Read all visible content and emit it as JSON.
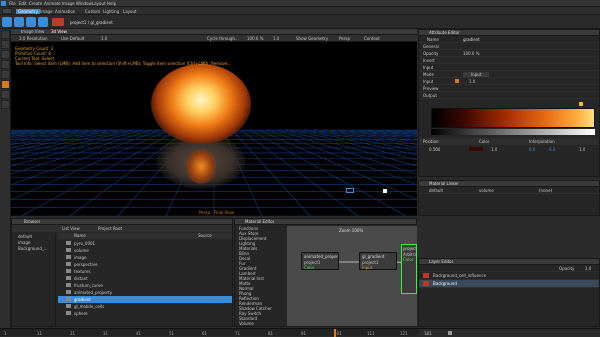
{
  "menubar": {
    "items": [
      "File",
      "Edit",
      "Create",
      "Animate",
      "Image",
      "Window",
      "Layout",
      "Help"
    ]
  },
  "toolbar": {
    "tabs": [
      "Geometry",
      "Image",
      "Animation",
      "Custom",
      "Lighting",
      "Layout"
    ],
    "breadcrumb": "project1 / gl_gradient"
  },
  "viewport": {
    "tabs": [
      "Image View",
      "3d View"
    ],
    "toolbar_items": [
      "3.0 Resolution",
      "Use Default",
      "1.0",
      "Cycle through...",
      "100.0 %",
      "1.0",
      "Show Geometry",
      "Persp",
      "Context"
    ],
    "overlay_lines": [
      "Geometry Count: 2",
      "Primitive Count: 8",
      "Current Tool: Select",
      "Tool Info: Select item (LMB); Add item to selection (Shift+LMB); Toggle item selection (Ctrl+LMB); Remove..."
    ],
    "footer": "Persp - Final View"
  },
  "attribute_editor": {
    "title": "Attribute Editor",
    "name_label": "Name",
    "name_value": "gradient",
    "tree": [
      "General",
      "Opacity",
      "Invert",
      "Input",
      "Mode",
      "Input",
      "Preview",
      "Output"
    ],
    "opacity_value": "100.0 %",
    "mode_value": "Input",
    "input_value": "1.0",
    "gradient_values": [
      "0.500",
      "1.0",
      "0.0",
      "0.0",
      "1.0"
    ],
    "gradient_stops": [
      "Position",
      "Color",
      "Interpolation"
    ]
  },
  "material_linker": {
    "title": "Material Linker",
    "items": [
      "default",
      "volume",
      "(none)"
    ]
  },
  "layer_editor": {
    "title": "Layer Editor",
    "opacity_label": "Opacity",
    "opacity_value": "1.0",
    "layers": [
      "Background_cell_influence",
      "Background"
    ]
  },
  "browser": {
    "title": "Browser",
    "tabs": [
      "List View",
      "Project Root"
    ],
    "columns": [
      "Name",
      "Source"
    ],
    "folders": [
      "default",
      "image",
      "Background_..."
    ],
    "files": [
      "pyro_0001",
      "volume",
      "image",
      "perspective",
      "textures",
      "distant",
      "frustum_curve",
      "animated_property",
      "gradient",
      "gl_mobile_cells",
      "sphere"
    ]
  },
  "material_editor": {
    "title": "Material Editor",
    "zoom": "Zoom 100%",
    "list": [
      "Functions",
      "Aux Store",
      "Displacement",
      "Lighting",
      "Materials",
      "Blinn",
      "Decal",
      "Fur",
      "Gradient",
      "Lambert",
      "Material Inst",
      "Matte",
      "Normal",
      "Phong",
      "Reflection",
      "Renderman",
      "Shadow Catcher",
      "Ray Switch",
      "Standard",
      "Volume"
    ],
    "nodes": [
      {
        "title": "animated_property",
        "sub": "project1",
        "port": "Color"
      },
      {
        "title": "gl_gradient",
        "sub": "project1",
        "port": "Input"
      },
      {
        "title": "project1",
        "sub": "Arbitrary Output",
        "port": "Color"
      }
    ]
  },
  "timeline": {
    "ticks": [
      "1",
      "11",
      "21",
      "31",
      "41",
      "51",
      "61",
      "71",
      "81",
      "91",
      "101",
      "111",
      "121"
    ],
    "current": "181"
  },
  "colors": {
    "accent": "#3b8cd9",
    "selection": "#d77a1e",
    "grid": "#123c7a",
    "viewport_bg": "#000000"
  }
}
